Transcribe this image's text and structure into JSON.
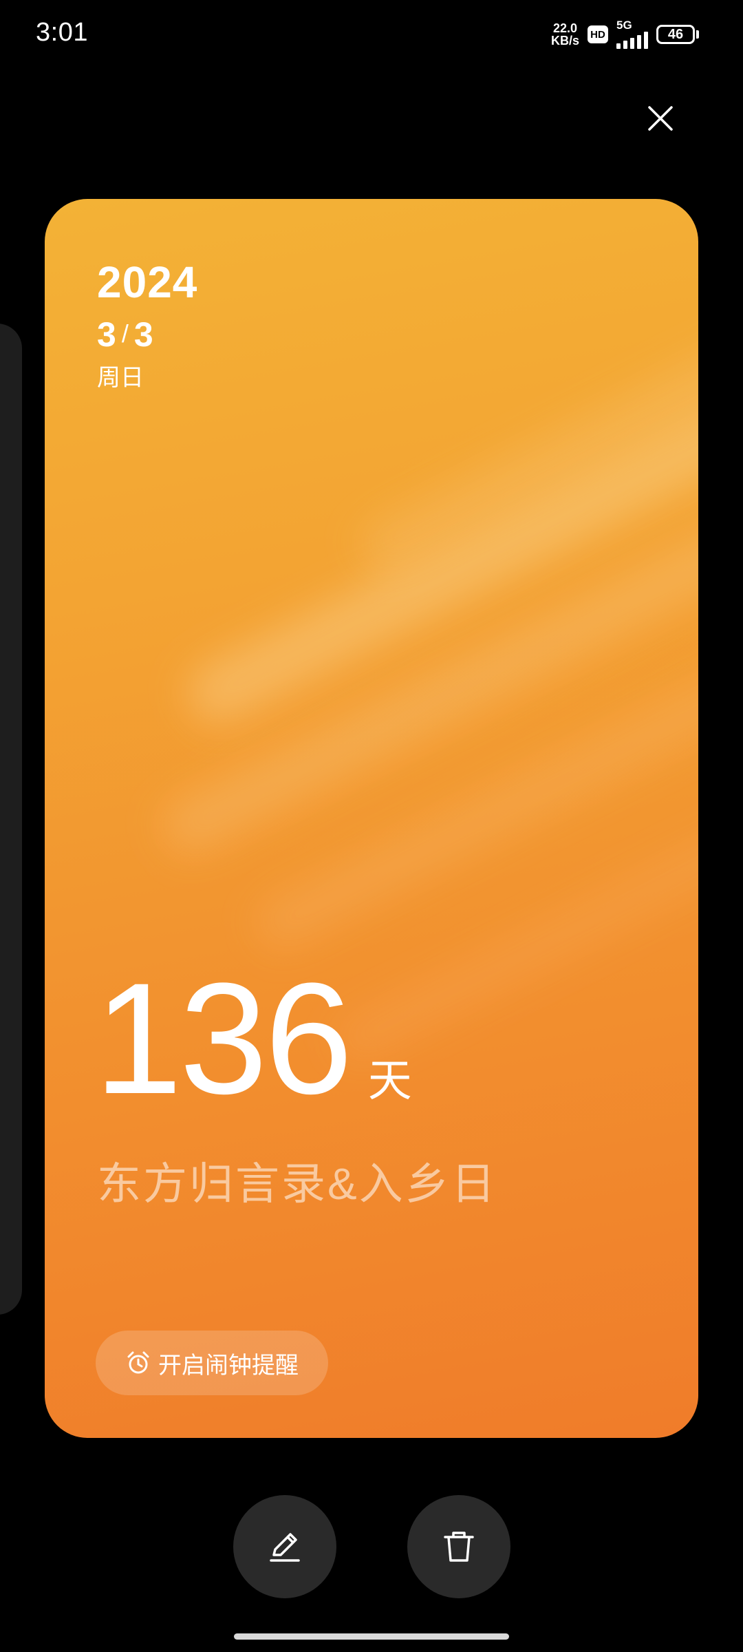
{
  "status_bar": {
    "time": "3:01",
    "net_speed_value": "22.0",
    "net_speed_unit": "KB/s",
    "hd_label": "HD",
    "network_type": "5G",
    "battery_level": "46"
  },
  "card": {
    "year": "2024",
    "month": "3",
    "date_separator": "/",
    "day": "3",
    "weekday": "周日",
    "count_number": "136",
    "count_unit": "天",
    "event_title": "东方归言录&入乡日",
    "alarm_button_label": "开启闹钟提醒",
    "accent_color": "#f3a433"
  },
  "actions": {
    "edit_icon": "pencil-icon",
    "delete_icon": "trash-icon"
  }
}
